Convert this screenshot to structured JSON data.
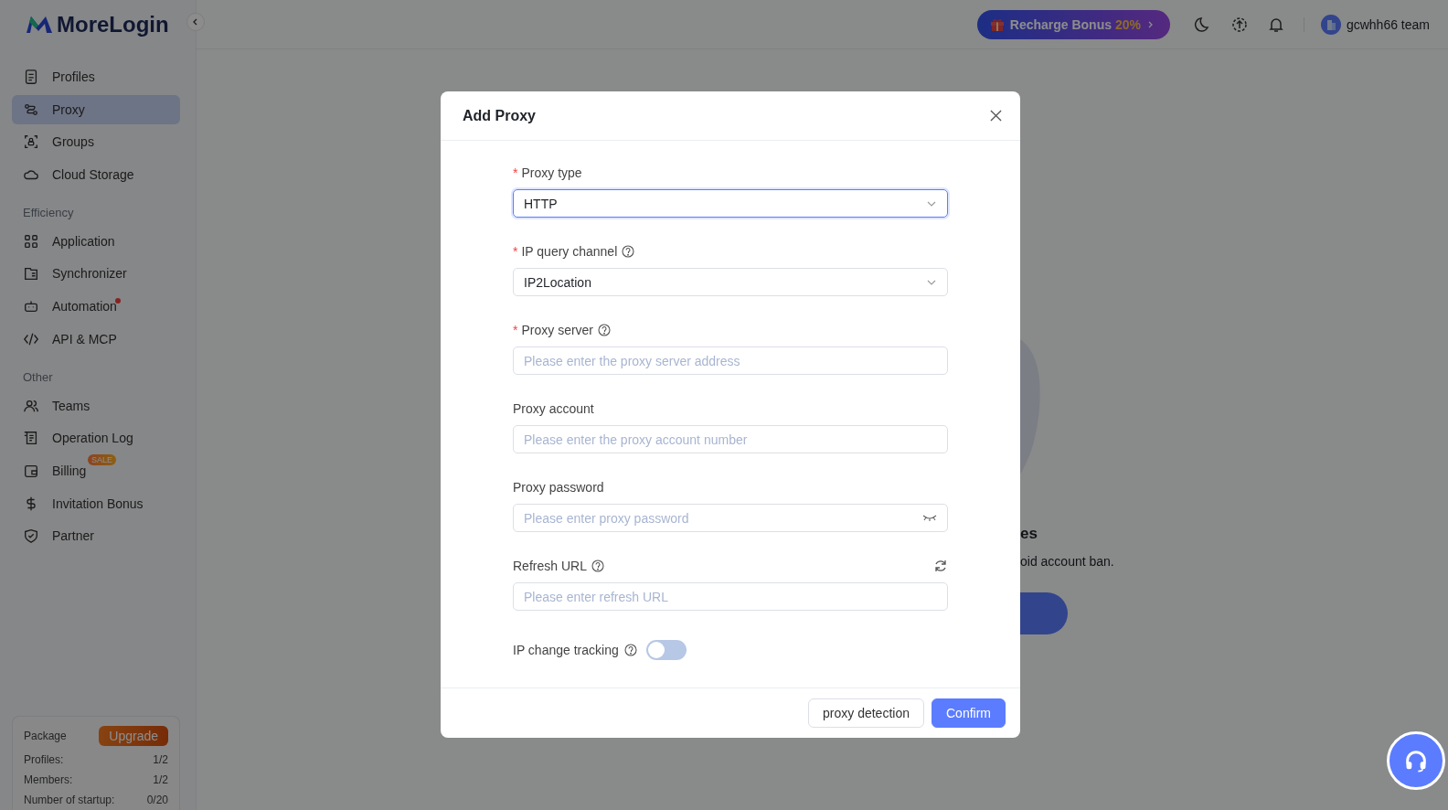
{
  "brand": {
    "name": "MoreLogin"
  },
  "sidebar": {
    "sections": [
      {
        "items": [
          {
            "label": "Profiles",
            "selected": false
          },
          {
            "label": "Proxy",
            "selected": true
          },
          {
            "label": "Groups",
            "selected": false
          },
          {
            "label": "Cloud Storage",
            "selected": false
          }
        ]
      },
      {
        "title": "Efficiency",
        "items": [
          {
            "label": "Application",
            "selected": false
          },
          {
            "label": "Synchronizer",
            "selected": false
          },
          {
            "label": "Automation",
            "selected": false,
            "dot": true
          },
          {
            "label": "API & MCP",
            "selected": false
          }
        ]
      },
      {
        "title": "Other",
        "items": [
          {
            "label": "Teams",
            "selected": false
          },
          {
            "label": "Operation Log",
            "selected": false
          },
          {
            "label": "Billing",
            "selected": false,
            "badge": "SALE"
          },
          {
            "label": "Invitation Bonus",
            "selected": false
          },
          {
            "label": "Partner",
            "selected": false
          }
        ]
      }
    ],
    "package": {
      "title": "Package",
      "upgrade": "Upgrade",
      "rows": [
        {
          "label": "Profiles:",
          "value": "1/2"
        },
        {
          "label": "Members:",
          "value": "1/2"
        },
        {
          "label": "Number of startup:",
          "value": "0/20"
        }
      ]
    }
  },
  "header": {
    "promo": {
      "text": "Recharge Bonus",
      "highlight": "20%"
    },
    "user": "gcwhh66 team"
  },
  "background_page": {
    "heading_fragment": "es",
    "text_fragment": "oid account ban."
  },
  "dialog": {
    "title": "Add Proxy",
    "fields": [
      {
        "kind": "select",
        "label": "Proxy type",
        "required_mark": "*",
        "help": false,
        "value": "HTTP",
        "focused": true
      },
      {
        "kind": "select",
        "label": "IP query channel",
        "required_mark": "*",
        "help": true,
        "value": "IP2Location",
        "focused": false
      },
      {
        "kind": "input",
        "label": "Proxy server",
        "required_mark": "*",
        "help": true,
        "placeholder": "Please enter the proxy server address",
        "focused": false
      },
      {
        "kind": "input",
        "label": "Proxy account",
        "help": false,
        "placeholder": "Please enter the proxy account number",
        "focused": false
      },
      {
        "kind": "password",
        "label": "Proxy password",
        "help": false,
        "placeholder": "Please enter proxy password",
        "focused": false
      },
      {
        "kind": "refresh",
        "label": "Refresh URL",
        "help": true,
        "placeholder": "Please enter refresh URL",
        "focused": false
      }
    ],
    "toggle": {
      "label": "IP change tracking",
      "on": false
    },
    "buttons": [
      {
        "kind": "secondary",
        "label": "proxy detection"
      },
      {
        "kind": "primary",
        "label": "Confirm"
      }
    ]
  }
}
